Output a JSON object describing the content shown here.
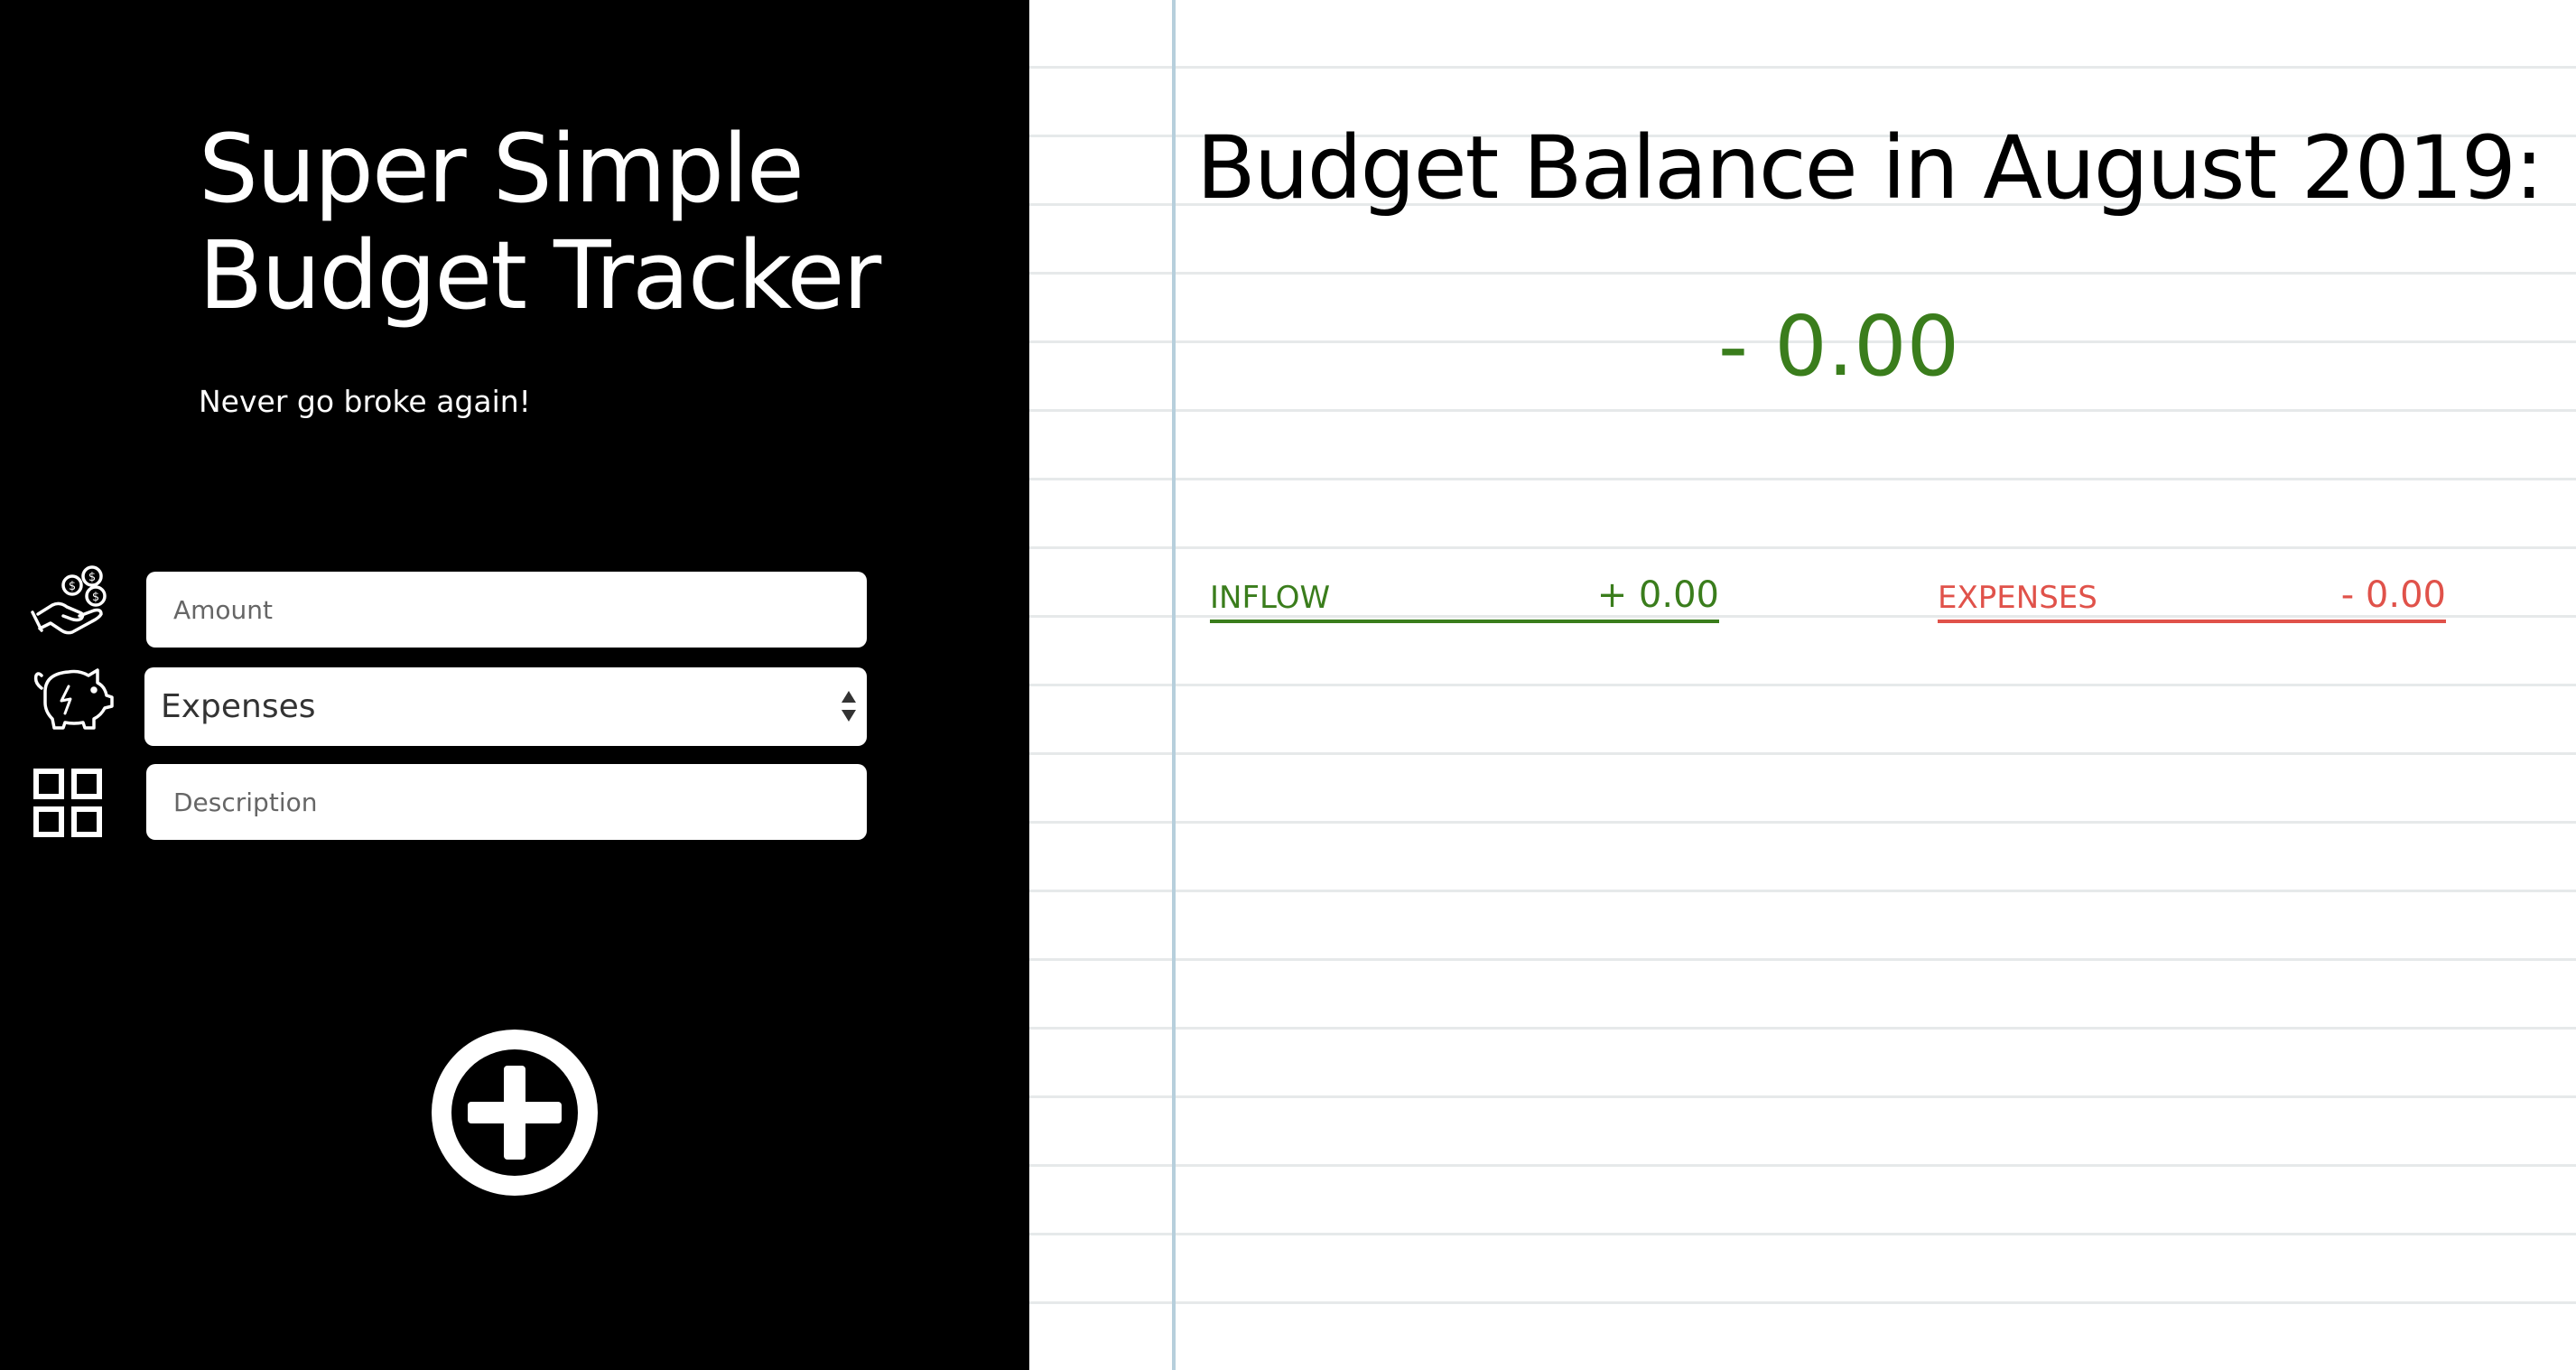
{
  "app": {
    "title_line1": "Super Simple",
    "title_line2": "Budget Tracker",
    "tagline": "Never go broke again!"
  },
  "form": {
    "amount": {
      "placeholder": "Amount",
      "value": "",
      "icon": "money-hand-icon"
    },
    "type": {
      "selected": "Expenses",
      "icon": "piggy-bank-icon"
    },
    "description": {
      "placeholder": "Description",
      "value": "",
      "icon": "category-grid-icon"
    },
    "add_button_icon": "plus-circle-icon"
  },
  "summary": {
    "heading": "Budget Balance in August 2019:",
    "balance": "- 0.00",
    "inflow": {
      "label": "INFLOW",
      "amount": "+ 0.00"
    },
    "expenses": {
      "label": "EXPENSES",
      "amount": "- 0.00"
    }
  },
  "colors": {
    "left_background": "#000000",
    "inflow_green": "#3a7d1c",
    "expenses_red": "#e0524a",
    "notebook_line": "#e6e9ea",
    "margin_line": "#b7cfdc"
  }
}
